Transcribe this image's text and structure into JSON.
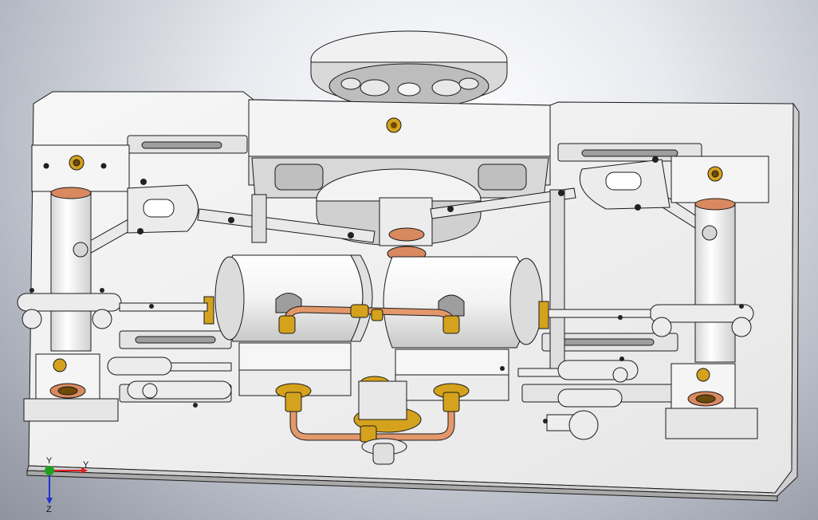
{
  "viewport": {
    "name": "cad-3d-viewport",
    "background_top": "#ffffff",
    "background_bottom": "#8d929e"
  },
  "model": {
    "name": "twin-cylinder-steam-engine",
    "part_color": "#f2f2f2",
    "edge_color": "#1a1a1a",
    "brass_color": "#d4a21c",
    "copper_color": "#d9895f"
  },
  "triad": {
    "x_label": "Y",
    "y_label": "Y",
    "z_label": "Z",
    "x_color": "#e02020",
    "y_color": "#20a020",
    "z_color": "#2030d0"
  }
}
